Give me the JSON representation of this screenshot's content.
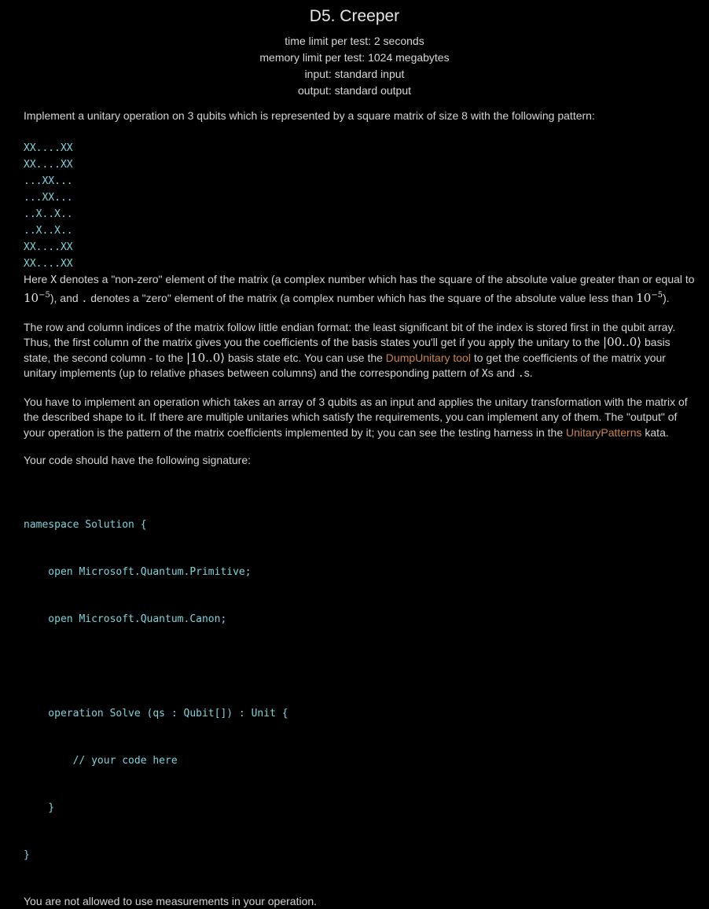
{
  "header": {
    "title": "D5. Creeper",
    "time_limit": "time limit per test: 2 seconds",
    "memory_limit": "memory limit per test: 1024 megabytes",
    "input": "input: standard input",
    "output": "output: standard output"
  },
  "intro": "Implement a unitary operation on 3 qubits which is represented by a square matrix of size 8 with the following pattern:",
  "pattern_rows": [
    "XX....XX",
    "XX....XX",
    "...XX...",
    "...XX...",
    "..X..X..",
    "..X..X..",
    "XX....XX",
    "XX....XX"
  ],
  "para_definition": {
    "t1": "Here ",
    "x_symbol": "X",
    "t2": " denotes a \"non-zero\" element of the matrix (a complex number which has the square of the absolute value greater than or equal to ",
    "ten1": "10",
    "exp1": "−5",
    "t3": "), and ",
    "dot_symbol": ".",
    "t4": " denotes a \"zero\" element of the matrix (a complex number which has the square of the absolute value less than ",
    "ten2": "10",
    "exp2": "−5",
    "t5": ")."
  },
  "para_indices": {
    "t1": "The row and column indices of the matrix follow little endian format: the least significant bit of the index is stored first in the qubit array. Thus, the first column of the matrix gives you the coefficients of the basis states you'll get if you apply the unitary to the ",
    "ket1": "|00..0⟩",
    "t2": " basis state, the second column - to the ",
    "ket2": "|10..0⟩",
    "t3": " basis state etc. You can use the ",
    "link1": "DumpUnitary tool",
    "t4": " to get the coefficients of the matrix your unitary implements (up to relative phases between columns) and the corresponding pattern of ",
    "xs_symbol": "X",
    "t5": "s and ",
    "dots_symbol": ".",
    "t6": "s."
  },
  "para_task": {
    "t1": "You have to implement an operation which takes an array of 3 qubits as an input and applies the unitary transformation with the matrix of the described shape to it. If there are multiple unitaries which satisfy the requirements, you can implement any of them. The \"output\" of your operation is the pattern of the matrix coefficients implemented by it; you can see the testing harness in the ",
    "link2": "UnitaryPatterns",
    "t2": " kata."
  },
  "signature_intro": "Your code should have the following signature:",
  "code_lines": [
    "namespace Solution {",
    "    open Microsoft.Quantum.Primitive;",
    "    open Microsoft.Quantum.Canon;",
    "",
    "    operation Solve (qs : Qubit[]) : Unit {",
    "        // your code here",
    "    }",
    "}"
  ],
  "footer_note": "You are not allowed to use measurements in your operation.",
  "colors": {
    "background": "#000000",
    "text": "#d4d4d4",
    "code": "#7fd3dc",
    "link": "#c9854a"
  }
}
